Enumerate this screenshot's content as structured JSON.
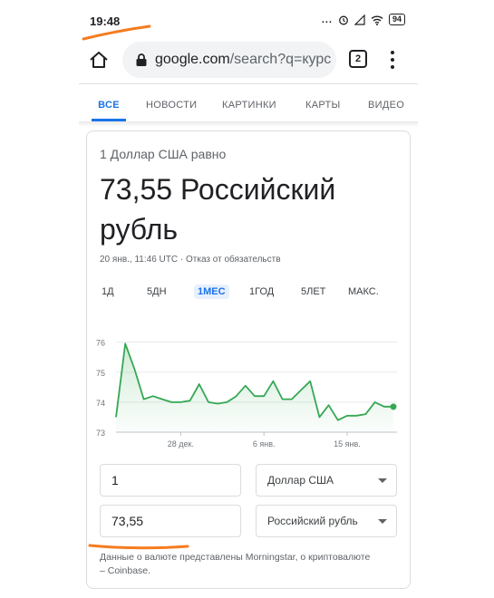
{
  "status_bar": {
    "time": "19:48",
    "signal": "...",
    "battery": "94"
  },
  "browser": {
    "url_host": "google.com",
    "url_path": "/search?q=курс",
    "tab_count": "2"
  },
  "search_nav": {
    "tabs": [
      "ВСЕ",
      "НОВОСТИ",
      "КАРТИНКИ",
      "КАРТЫ",
      "ВИДЕО"
    ],
    "active": "ВСЕ"
  },
  "converter": {
    "equals_text": "1 Доллар США равно",
    "result_value": "73,55 Российский рубль",
    "timestamp": "20 янв., 11:46 UTC · ",
    "disclaimer": "Отказ от обязательств",
    "ranges": [
      "1Д",
      "5ДН",
      "1МЕС",
      "1ГОД",
      "5ЛЕТ",
      "МАКС."
    ],
    "active_range": "1МЕС",
    "from_amount": "1",
    "from_currency": "Доллар США",
    "to_amount": "73,55",
    "to_currency": "Российский рубль",
    "source_note": "Данные о валюте представлены Morningstar, о криптовалюте – Coinbase."
  },
  "colors": {
    "accent": "#1a73e8",
    "line": "#34a853",
    "annotation": "#f57c1f"
  },
  "chart_data": {
    "type": "area",
    "x": [
      "21 дек.",
      "22 дек.",
      "23 дек.",
      "24 дек.",
      "25 дек.",
      "26 дек.",
      "27 дек.",
      "28 дек.",
      "29 дек.",
      "30 дек.",
      "31 дек.",
      "1 янв.",
      "2 янв.",
      "3 янв.",
      "4 янв.",
      "5 янв.",
      "6 янв.",
      "7 янв.",
      "8 янв.",
      "9 янв.",
      "10 янв.",
      "11 янв.",
      "12 янв.",
      "13 янв.",
      "14 янв.",
      "15 янв.",
      "16 янв.",
      "17 янв.",
      "18 янв.",
      "19 янв.",
      "20 янв."
    ],
    "values": [
      73.5,
      75.95,
      75.1,
      74.1,
      74.2,
      74.1,
      74.0,
      74.0,
      74.05,
      74.6,
      74.0,
      73.95,
      74.0,
      74.2,
      74.55,
      74.2,
      74.2,
      74.7,
      74.1,
      74.1,
      74.4,
      74.7,
      73.5,
      73.9,
      73.4,
      73.55,
      73.55,
      73.6,
      74.0,
      73.85,
      73.85
    ],
    "ylim": [
      73,
      76.2
    ],
    "yticks": [
      "76",
      "75",
      "74",
      "73"
    ],
    "xticks": [
      "28 дек.",
      "6 янв.",
      "15 янв."
    ],
    "grid": true
  }
}
